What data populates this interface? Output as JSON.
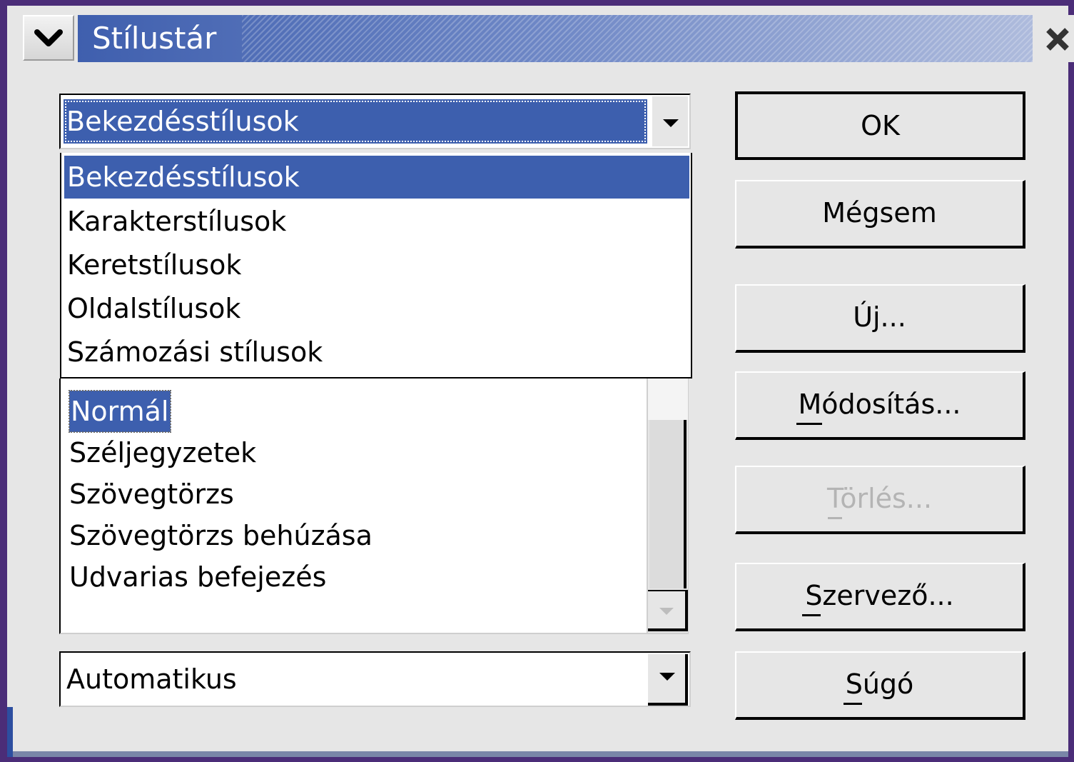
{
  "window": {
    "title": "Stílustár"
  },
  "category_combo": {
    "value": "Bekezdésstílusok",
    "options": [
      "Bekezdésstílusok",
      "Karakterstílusok",
      "Keretstílusok",
      "Oldalstílusok",
      "Számozási stílusok"
    ]
  },
  "style_list": {
    "items": [
      "Normál",
      "Széljegyzetek",
      "Szövegtörzs",
      "Szövegtörzs behúzása",
      "Udvarias befejezés"
    ],
    "selected": "Normál"
  },
  "filter_combo": {
    "value": "Automatikus"
  },
  "buttons": {
    "ok": "OK",
    "cancel": "Mégsem",
    "new": "Új...",
    "modify": "Módosítás...",
    "delete": "Törlés...",
    "organizer": "Szervező...",
    "help": "Súgó"
  },
  "colors": {
    "selection": "#3d5fae",
    "dialog_bg": "#e6e6e6",
    "desktop": "#4b2d78",
    "disabled_text": "#b4b4b4"
  },
  "icons": {
    "window_menu": "chevron-down-icon",
    "close": "close-icon",
    "dropdown": "triangle-down-icon"
  }
}
